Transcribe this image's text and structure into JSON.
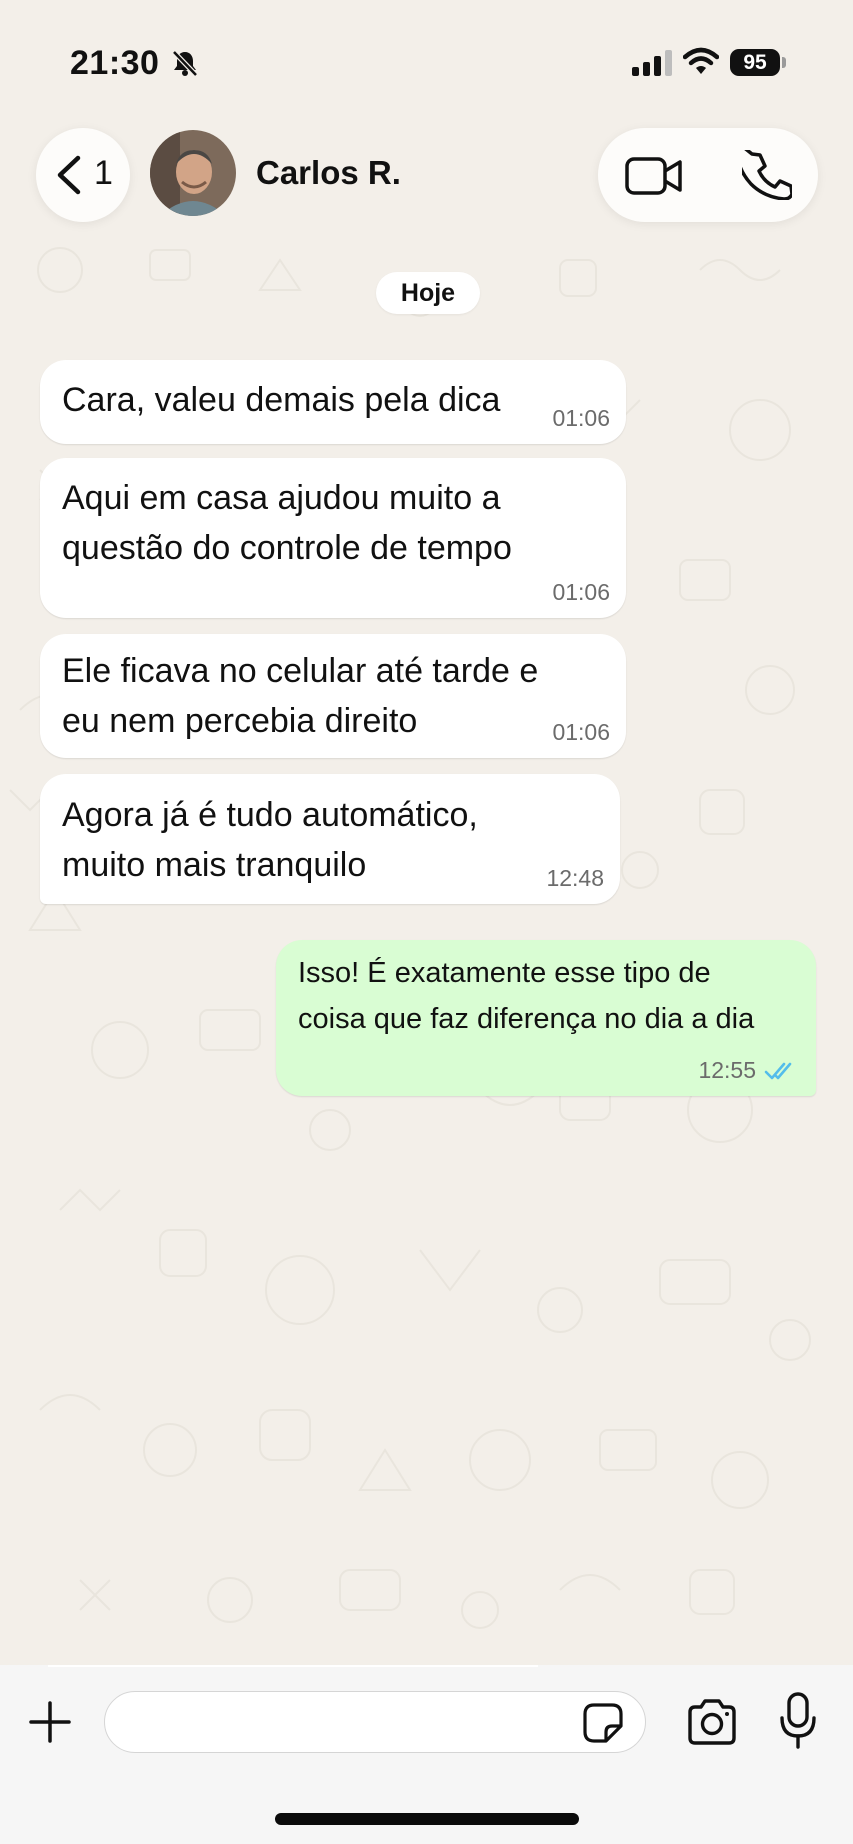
{
  "status_bar": {
    "time": "21:30",
    "battery": "95"
  },
  "header": {
    "back_count": "1",
    "contact_name": "Carlos R."
  },
  "chat": {
    "date_label": "Hoje",
    "messages": [
      {
        "direction": "in",
        "lines": [
          "Cara, valeu demais pela dica"
        ],
        "time": "01:06"
      },
      {
        "direction": "in",
        "lines": [
          "Aqui em casa ajudou muito a",
          "questão do controle de tempo"
        ],
        "time": "01:06"
      },
      {
        "direction": "in",
        "lines": [
          "Ele ficava no celular até tarde e",
          "eu nem percebia direito"
        ],
        "time": "01:06"
      },
      {
        "direction": "in",
        "lines": [
          "Agora já é tudo automático,",
          "muito mais tranquilo"
        ],
        "time": "12:48"
      },
      {
        "direction": "out",
        "lines": [
          "Isso! É exatamente esse tipo de",
          "coisa que faz diferença no dia a dia"
        ],
        "time": "12:55",
        "status": "read"
      }
    ]
  },
  "input": {
    "placeholder": ""
  },
  "colors": {
    "background": "#f3efe9",
    "incoming": "#ffffff",
    "outgoing": "#d9fdd3",
    "read_tick": "#53bdeb"
  },
  "icons": [
    "bell-slash-icon",
    "signal-icon",
    "wifi-icon",
    "chevron-left-icon",
    "video-camera-icon",
    "phone-icon",
    "plus-icon",
    "sticker-icon",
    "camera-icon",
    "microphone-icon",
    "double-check-icon"
  ]
}
